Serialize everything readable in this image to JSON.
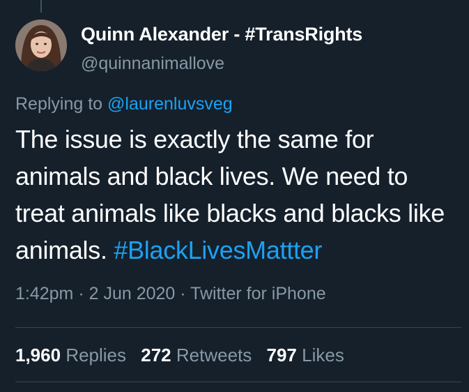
{
  "tweet": {
    "display_name": "Quinn Alexander - #TransRights",
    "handle": "@quinnanimallove",
    "replying_prefix": "Replying to ",
    "replying_to": "@laurenluvsveg",
    "text": "The issue is exactly the same for animals and black lives. We need to treat animals like blacks and blacks like animals. ",
    "hashtag": "#BlackLivesMattter",
    "time": "1:42pm",
    "separator": " · ",
    "date": "2 Jun 2020",
    "source": "Twitter for iPhone"
  },
  "stats": {
    "replies_count": "1,960",
    "replies_label": "Replies",
    "retweets_count": "272",
    "retweets_label": "Retweets",
    "likes_count": "797",
    "likes_label": "Likes"
  },
  "colors": {
    "background": "#15202b",
    "link": "#1da1f2",
    "muted": "#8899a6",
    "divider": "#38444d"
  },
  "icons": {
    "avatar": "profile-photo"
  }
}
